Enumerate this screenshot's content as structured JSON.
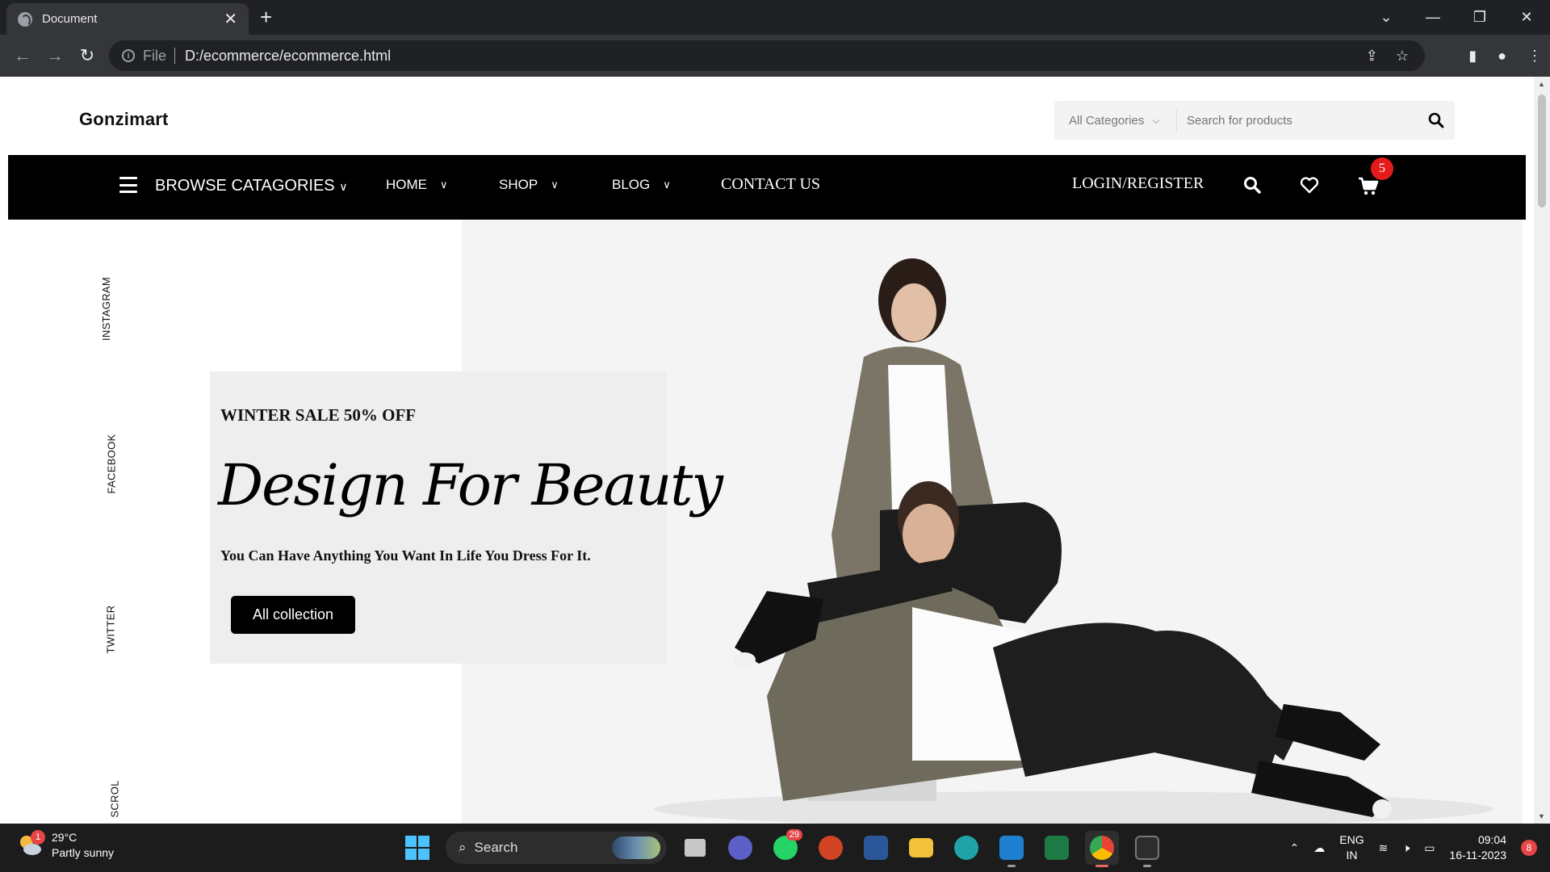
{
  "browser": {
    "tab_title": "Document",
    "new_tab": "+",
    "address_scheme": "File",
    "address_url": "D:/ecommerce/ecommerce.html"
  },
  "site": {
    "logo": "Gonzimart",
    "search": {
      "category": "All Categories",
      "placeholder": "Search for products"
    },
    "nav": {
      "browse": "BROWSE CATAGORIES",
      "items": [
        "HOME",
        "SHOP",
        "BLOG"
      ],
      "contact": "CONTACT US",
      "login": "LOGIN/REGISTER",
      "cart_count": "5"
    },
    "social": [
      "INSTAGRAM",
      "FACEBOOK",
      "TWITTER",
      "SCROL"
    ],
    "hero": {
      "sale": "WINTER SALE 50% OFF",
      "headline": "Design For Beauty",
      "tagline": "You Can Have Anything You Want In Life You Dress For It.",
      "cta": "All collection"
    }
  },
  "taskbar": {
    "weather_alert": "1",
    "temperature": "29°C",
    "condition": "Partly sunny",
    "search_label": "Search",
    "whatsapp_count": "29",
    "language": "ENG",
    "region": "IN",
    "time": "09:04",
    "date": "16-11-2023",
    "notifications": "8"
  }
}
